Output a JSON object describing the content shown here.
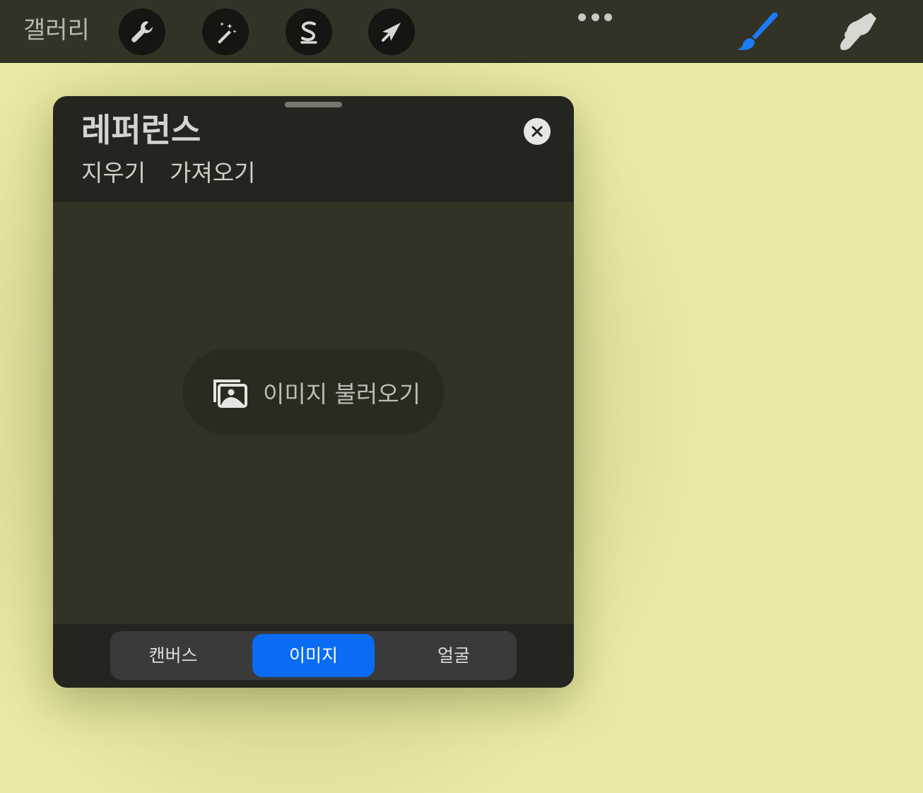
{
  "toolbar": {
    "gallery_label": "갤러리",
    "tools": [
      {
        "name": "actions",
        "icon": "wrench-icon"
      },
      {
        "name": "adjustments",
        "icon": "magic-wand-icon"
      },
      {
        "name": "selection",
        "icon": "selection-s-icon"
      },
      {
        "name": "transform",
        "icon": "arrow-cursor-icon"
      }
    ],
    "more_icon": "ellipsis-icon",
    "brush_icon": "brush-icon",
    "smudge_icon": "smudge-icon",
    "accent_color": "#0a6cf2"
  },
  "panel": {
    "title": "레퍼런스",
    "actions": [
      "지우기",
      "가져오기"
    ],
    "close_icon": "close-icon",
    "import_button_label": "이미지 불러오기",
    "import_icon": "photo-stack-icon",
    "segments": [
      "캔버스",
      "이미지",
      "얼굴"
    ],
    "selected_segment": "이미지"
  },
  "colors": {
    "canvas": "#e9e9a3",
    "panel_bg": "#333325",
    "selected_segment": "#0a6cf2"
  }
}
